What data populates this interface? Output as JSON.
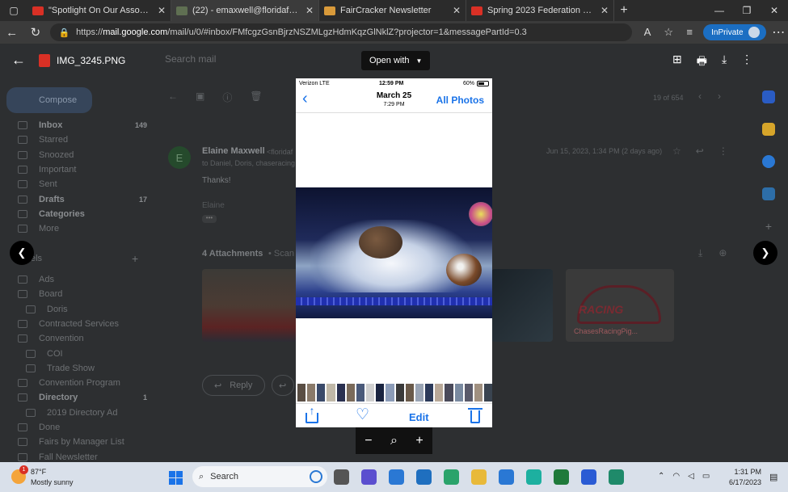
{
  "browser": {
    "tabs": [
      {
        "title": "\"Spotlight On Our Associates\" -",
        "color": "#d93025",
        "active": false
      },
      {
        "title": "(22) - emaxwell@floridafairs.org",
        "color": "#5f6f52",
        "active": true
      },
      {
        "title": "FairCracker Newsletter",
        "color": "#d99a3a",
        "active": false
      },
      {
        "title": "Spring 2023 Federation Newslett",
        "color": "#d93025",
        "active": false
      }
    ],
    "url_prefix": "https://",
    "url_host": "mail.google.com",
    "url_path": "/mail/u/0/#inbox/FMfcgzGsnBjrzNSZMLgzHdmKqzGlNklZ?projector=1&messagePartId=0.3",
    "inprivate_label": "InPrivate"
  },
  "viewer": {
    "file_name": "IMG_3245.PNG",
    "open_with_label": "Open with"
  },
  "gmail": {
    "search_placeholder": "Search mail",
    "compose_label": "Compose",
    "nav": [
      {
        "label": "Inbox",
        "count": "149",
        "bold": true
      },
      {
        "label": "Starred",
        "count": "",
        "bold": false
      },
      {
        "label": "Snoozed",
        "count": "",
        "bold": false
      },
      {
        "label": "Important",
        "count": "",
        "bold": false
      },
      {
        "label": "Sent",
        "count": "",
        "bold": false
      },
      {
        "label": "Drafts",
        "count": "17",
        "bold": true
      },
      {
        "label": "Categories",
        "count": "",
        "bold": true
      },
      {
        "label": "More",
        "count": "",
        "bold": false
      }
    ],
    "labels_heading": "els",
    "labels": [
      {
        "label": "Ads",
        "indent": 0,
        "bold": false,
        "count": ""
      },
      {
        "label": "Board",
        "indent": 0,
        "bold": false,
        "count": ""
      },
      {
        "label": "Doris",
        "indent": 1,
        "bold": false,
        "count": ""
      },
      {
        "label": "Contracted Services",
        "indent": 0,
        "bold": false,
        "count": ""
      },
      {
        "label": "Convention",
        "indent": 0,
        "bold": false,
        "count": ""
      },
      {
        "label": "COI",
        "indent": 1,
        "bold": false,
        "count": ""
      },
      {
        "label": "Trade Show",
        "indent": 1,
        "bold": false,
        "count": ""
      },
      {
        "label": "Convention Program",
        "indent": 0,
        "bold": false,
        "count": ""
      },
      {
        "label": "Directory",
        "indent": 0,
        "bold": true,
        "count": "1"
      },
      {
        "label": "2019 Directory Ad",
        "indent": 1,
        "bold": false,
        "count": ""
      },
      {
        "label": "Done",
        "indent": 0,
        "bold": false,
        "count": ""
      },
      {
        "label": "Fairs by Manager List",
        "indent": 0,
        "bold": false,
        "count": ""
      },
      {
        "label": "Fall Newsletter",
        "indent": 0,
        "bold": false,
        "count": ""
      }
    ],
    "pager": "19 of 654",
    "message": {
      "avatar_letter": "E",
      "sender": "Elaine Maxwell",
      "sender_email": "<floridaf",
      "to": "to Daniel, Doris, chaseracing",
      "date": "Jun 15, 2023, 1:34 PM (2 days ago)",
      "body": "Thanks!",
      "signature": "Elaine",
      "ellipsis": "•••"
    },
    "attachments_heading": "4 Attachments",
    "attachments_scan": "• Scan",
    "attachment_pig_name": "ChasesRacingPig...",
    "attachment_racing_word": "RACING",
    "reply_label": "Reply"
  },
  "phone": {
    "carrier": "Verizon  LTE",
    "time": "12:59 PM",
    "battery": "60%",
    "date": "March 25",
    "sub_time": "7:29 PM",
    "all_photos": "All Photos",
    "edit": "Edit"
  },
  "taskbar": {
    "weather_badge": "1",
    "temperature": "87°F",
    "condition": "Mostly sunny",
    "search_label": "Search",
    "time": "1:31 PM",
    "date": "6/17/2023",
    "apps": [
      "#555555",
      "#5b4fcf",
      "#2a78d4",
      "#1f6fbf",
      "#2aa36b",
      "#e8b93a",
      "#2a78d4",
      "#1db0a0",
      "#1f7a3a",
      "#2a5bd4",
      "#1f8a6a"
    ]
  }
}
